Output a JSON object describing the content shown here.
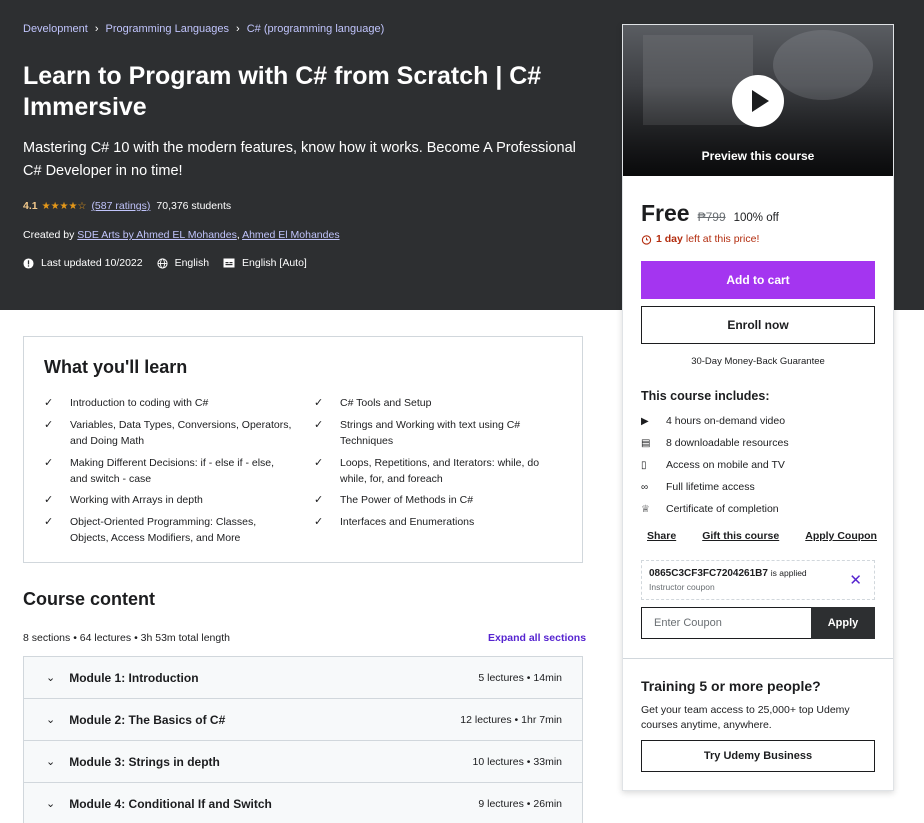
{
  "breadcrumb": [
    "Development",
    "Programming Languages",
    "C# (programming language)"
  ],
  "course": {
    "title": "Learn to Program with C# from Scratch | C# Immersive",
    "subtitle": "Mastering C# 10 with the modern features, know how it works. Become A Professional C# Developer in no time!",
    "rating": "4.1",
    "stars": "★★★★☆",
    "ratings_count": "(587 ratings)",
    "students": "70,376 students",
    "created_by_label": "Created by",
    "author1": "SDE Arts by Ahmed EL Mohandes",
    "author_sep": ",",
    "author2": "Ahmed El Mohandes",
    "last_updated": "Last updated 10/2022",
    "language": "English",
    "captions": "English [Auto]"
  },
  "learn": {
    "title": "What you'll learn",
    "items": [
      "Introduction to coding with C#",
      "C# Tools and Setup",
      "Variables, Data Types, Conversions, Operators, and Doing Math",
      "Strings and Working with text using C# Techniques",
      "Making Different Decisions: if - else if - else, and switch - case",
      "Loops, Repetitions, and Iterators: while, do while, for, and foreach",
      "Working with Arrays in depth",
      "The Power of Methods in C#",
      "Object-Oriented Programming: Classes, Objects, Access Modifiers, and More",
      "Interfaces and Enumerations"
    ]
  },
  "content": {
    "title": "Course content",
    "summary": "8 sections • 64 lectures • 3h 53m total length",
    "expand_label": "Expand all sections",
    "modules": [
      {
        "name": "Module 1: Introduction",
        "meta": "5 lectures • 14min"
      },
      {
        "name": "Module 2: The Basics of C#",
        "meta": "12 lectures • 1hr 7min"
      },
      {
        "name": "Module 3: Strings in depth",
        "meta": "10 lectures • 33min"
      },
      {
        "name": "Module 4: Conditional If and Switch",
        "meta": "9 lectures • 26min"
      }
    ]
  },
  "sidebar": {
    "preview_label": "Preview this course",
    "price": "Free",
    "old_price": "₱799",
    "discount": "100% off",
    "deadline_bold": "1 day",
    "deadline_rest": "left at this price!",
    "add_to_cart": "Add to cart",
    "enroll": "Enroll now",
    "guarantee": "30-Day Money-Back Guarantee",
    "includes_title": "This course includes:",
    "includes": [
      {
        "icon": "video-icon",
        "text": "4 hours on-demand video"
      },
      {
        "icon": "file-download-icon",
        "text": "8 downloadable resources"
      },
      {
        "icon": "mobile-icon",
        "text": "Access on mobile and TV"
      },
      {
        "icon": "infinity-icon",
        "text": "Full lifetime access"
      },
      {
        "icon": "trophy-icon",
        "text": "Certificate of completion"
      }
    ],
    "share": "Share",
    "gift": "Gift this course",
    "apply_coupon": "Apply Coupon",
    "coupon_code": "0865C3CF3FC7204261B7",
    "coupon_applied": "is applied",
    "coupon_sub": "Instructor coupon",
    "coupon_placeholder": "Enter Coupon",
    "coupon_apply_btn": "Apply",
    "training_title": "Training 5 or more people?",
    "training_text": "Get your team access to 25,000+ top Udemy courses anytime, anywhere.",
    "business_btn": "Try Udemy Business"
  },
  "colors": {
    "hero_bg": "#2d2f31",
    "accent_purple": "#a435f0",
    "link_purple": "#5624d0",
    "star_color": "#e59819",
    "deadline_red": "#b32d0f"
  }
}
